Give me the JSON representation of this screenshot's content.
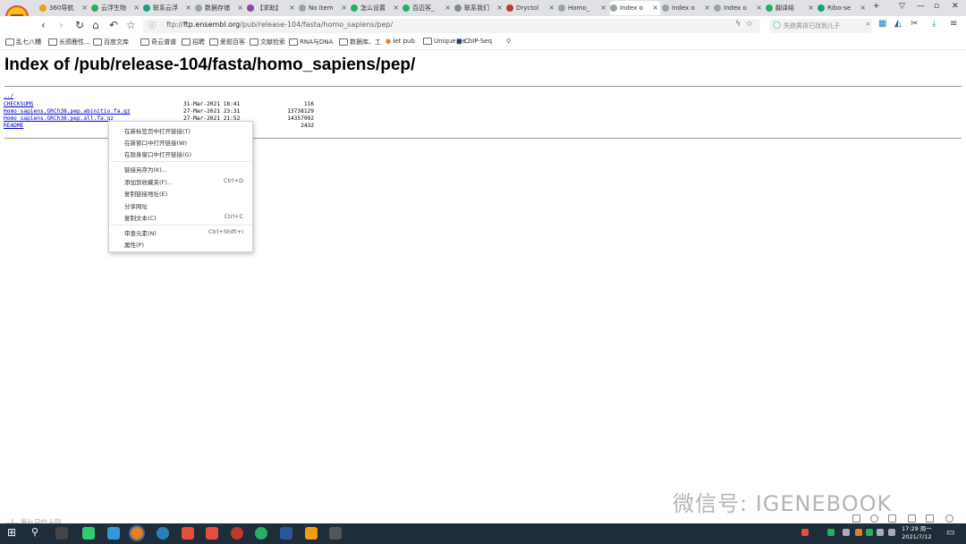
{
  "tabs": [
    {
      "label": "360导航",
      "color": "#f39c12"
    },
    {
      "label": "云浮生物",
      "color": "#27ae60"
    },
    {
      "label": "联系云浮",
      "color": "#16a085"
    },
    {
      "label": "数据存储",
      "color": "#95a5a6"
    },
    {
      "label": "【求助】",
      "color": "#8e44ad"
    },
    {
      "label": "No item",
      "color": "#95a5a6"
    },
    {
      "label": "怎么设置",
      "color": "#27ae60"
    },
    {
      "label": "百迈客_",
      "color": "#27ae60"
    },
    {
      "label": "联系我们",
      "color": "#7f8c8d"
    },
    {
      "label": "Dryctol",
      "color": "#c0392b"
    },
    {
      "label": "Homo_",
      "color": "#95a5a6"
    },
    {
      "label": "Index o",
      "color": "#95a5a6"
    },
    {
      "label": "Index o",
      "color": "#95a5a6"
    },
    {
      "label": "Index o",
      "color": "#95a5a6"
    },
    {
      "label": "翻译结",
      "color": "#27ae60"
    },
    {
      "label": "Ribo-se",
      "color": "#16a085"
    }
  ],
  "active_tab_index": 11,
  "address": {
    "prefix": "ftp://",
    "host": "ftp.ensembl.org",
    "path": "/pub/release-104/fasta/homo_sapiens/pep/"
  },
  "search": {
    "placeholder": "失踪男孩已找到儿子"
  },
  "bookmarks": [
    "乱七八糟",
    "长颈鹿性...",
    "百度文库",
    "奇云谱谱",
    "招聘",
    "爱题百客",
    "文献检索",
    "RNA与DNA",
    "数据库、工",
    "let pub",
    "Unique ge...",
    "ChIP-Seq"
  ],
  "page": {
    "title": "Index of /pub/release-104/fasta/homo_sapiens/pep/",
    "parent_link": "../",
    "files": [
      {
        "name": "CHECKSUMS",
        "date": "31-Mar-2021 18:41",
        "size": "116"
      },
      {
        "name": "Homo_sapiens.GRCh38.pep.abinitio.fa.gz",
        "date": "27-Mar-2021 23:31",
        "size": "13738129"
      },
      {
        "name": "Homo_sapiens.GRCh38.pep.all.fa.gz",
        "date": "27-Mar-2021 21:52",
        "size": "14357992"
      },
      {
        "name": "README",
        "date": "",
        "size": "2432"
      }
    ]
  },
  "context_menu": {
    "items": [
      {
        "label": "在新标签页中打开链接(T)",
        "shortcut": ""
      },
      {
        "label": "在新窗口中打开链接(W)",
        "shortcut": ""
      },
      {
        "label": "在隐身窗口中打开链接(G)",
        "shortcut": ""
      },
      {
        "label": "链接另存为(K)...",
        "shortcut": ""
      },
      {
        "label": "添加到收藏夹(F)...",
        "shortcut": "Ctrl+D"
      },
      {
        "label": "复制链接地址(E)",
        "shortcut": ""
      },
      {
        "label": "分享网址",
        "shortcut": ""
      },
      {
        "label": "复制文本(C)",
        "shortcut": "Ctrl+C"
      },
      {
        "label": "审查元素(N)",
        "shortcut": "Ctrl+Shift+I"
      },
      {
        "label": "属性(P)",
        "shortcut": ""
      }
    ]
  },
  "watermark": {
    "wechat": "微信号: IGENEBOOK",
    "corner": "大数跨境"
  },
  "clock": {
    "time": "17:29 周一",
    "date": "2021/7/12"
  },
  "colors": {
    "link": "#0000cc",
    "taskbar": "#1f2d3a",
    "tabbar": "#dfe1e5"
  }
}
